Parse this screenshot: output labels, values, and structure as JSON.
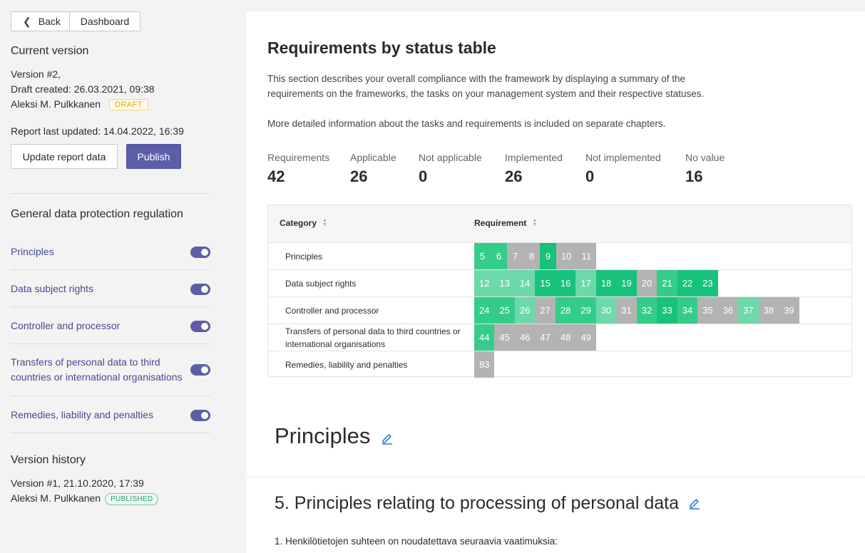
{
  "nav": {
    "back_label": "Back",
    "dashboard_label": "Dashboard"
  },
  "current": {
    "title": "Current version",
    "version": "Version #2,",
    "draft_created": "Draft created: 26.03.2021, 09:38",
    "author": "Aleksi M. Pulkkanen",
    "status_badge": "DRAFT",
    "last_updated": "Report last updated: 14.04.2022, 16:39",
    "update_button": "Update report data",
    "publish_button": "Publish"
  },
  "framework": {
    "title": "General data protection regulation",
    "items": [
      {
        "label": "Principles",
        "enabled": true
      },
      {
        "label": "Data subject rights",
        "enabled": true
      },
      {
        "label": "Controller and processor",
        "enabled": true
      },
      {
        "label": "Transfers of personal data to third countries or international organisations",
        "enabled": true
      },
      {
        "label": "Remedies, liability and penalties",
        "enabled": true
      }
    ]
  },
  "history": {
    "title": "Version history",
    "version": "Version #1, 21.10.2020, 17:39",
    "author": "Aleksi M. Pulkkanen",
    "status_badge": "PUBLISHED"
  },
  "main": {
    "title": "Requirements by status table",
    "desc1": "This section describes your overall compliance with the framework by displaying a summary of the requirements on the frameworks, the tasks on your management system and their respective statuses.",
    "desc2": "More detailed information about the tasks and requirements is included on separate chapters.",
    "stats": [
      {
        "label": "Requirements",
        "value": "42"
      },
      {
        "label": "Applicable",
        "value": "26"
      },
      {
        "label": "Not applicable",
        "value": "0"
      },
      {
        "label": "Implemented",
        "value": "26"
      },
      {
        "label": "Not implemented",
        "value": "0"
      },
      {
        "label": "No value",
        "value": "16"
      }
    ],
    "table": {
      "col_category": "Category",
      "col_requirement": "Requirement",
      "rows": [
        {
          "category": "Principles",
          "cells": [
            {
              "n": "5",
              "s": "mid"
            },
            {
              "n": "6",
              "s": "mid"
            },
            {
              "n": "7",
              "s": "gray"
            },
            {
              "n": "8",
              "s": "gray"
            },
            {
              "n": "9",
              "s": "dark"
            },
            {
              "n": "10",
              "s": "gray"
            },
            {
              "n": "11",
              "s": "gray"
            }
          ]
        },
        {
          "category": "Data subject rights",
          "cells": [
            {
              "n": "12",
              "s": "light"
            },
            {
              "n": "13",
              "s": "light"
            },
            {
              "n": "14",
              "s": "light"
            },
            {
              "n": "15",
              "s": "dark"
            },
            {
              "n": "16",
              "s": "dark"
            },
            {
              "n": "17",
              "s": "light"
            },
            {
              "n": "18",
              "s": "dark"
            },
            {
              "n": "19",
              "s": "dark"
            },
            {
              "n": "20",
              "s": "gray"
            },
            {
              "n": "21",
              "s": "mid"
            },
            {
              "n": "22",
              "s": "dark"
            },
            {
              "n": "23",
              "s": "dark"
            }
          ]
        },
        {
          "category": "Controller and processor",
          "cells": [
            {
              "n": "24",
              "s": "mid"
            },
            {
              "n": "25",
              "s": "mid"
            },
            {
              "n": "26",
              "s": "light"
            },
            {
              "n": "27",
              "s": "gray"
            },
            {
              "n": "28",
              "s": "mid"
            },
            {
              "n": "29",
              "s": "mid"
            },
            {
              "n": "30",
              "s": "light"
            },
            {
              "n": "31",
              "s": "gray"
            },
            {
              "n": "32",
              "s": "mid"
            },
            {
              "n": "33",
              "s": "dark"
            },
            {
              "n": "34",
              "s": "mid"
            },
            {
              "n": "35",
              "s": "gray"
            },
            {
              "n": "36",
              "s": "gray"
            },
            {
              "n": "37",
              "s": "light"
            },
            {
              "n": "38",
              "s": "gray"
            },
            {
              "n": "39",
              "s": "gray"
            }
          ]
        },
        {
          "category": "Transfers of personal data to third countries or international organisations",
          "cells": [
            {
              "n": "44",
              "s": "mid"
            },
            {
              "n": "45",
              "s": "gray"
            },
            {
              "n": "46",
              "s": "gray"
            },
            {
              "n": "47",
              "s": "gray"
            },
            {
              "n": "48",
              "s": "gray"
            },
            {
              "n": "49",
              "s": "gray"
            }
          ]
        },
        {
          "category": "Remedies, liability and penalties",
          "cells": [
            {
              "n": "83",
              "s": "gray"
            }
          ]
        }
      ]
    },
    "section_heading": "Principles",
    "article_heading": "5. Principles relating to processing of personal data",
    "article_text": "1. Henkilötietojen suhteen on noudatettava seuraavia vaatimuksia:"
  },
  "colors": {
    "accent": "#5b5ea6",
    "dark": "#17c27b",
    "mid": "#35cc8a",
    "light": "#6dd9a9",
    "gray": "#b3b3b3"
  }
}
